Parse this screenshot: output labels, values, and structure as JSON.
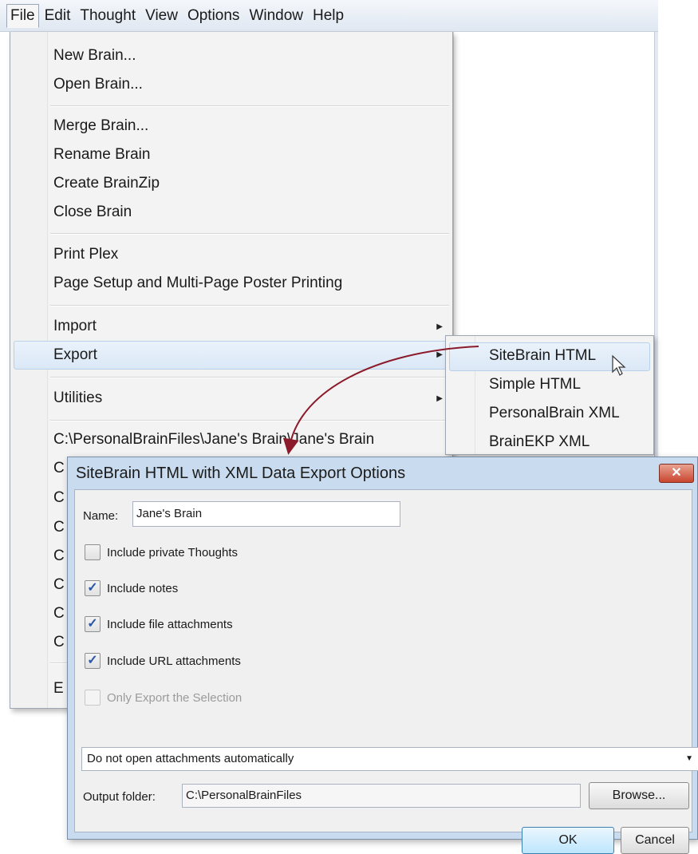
{
  "menubar": {
    "items": [
      "File",
      "Edit",
      "Thought",
      "View",
      "Options",
      "Window",
      "Help"
    ]
  },
  "file_menu": {
    "new_brain": "New Brain...",
    "open_brain": "Open Brain...",
    "merge_brain": "Merge Brain...",
    "rename_brain": "Rename Brain",
    "create_brainzip": "Create BrainZip",
    "close_brain": "Close Brain",
    "print_plex": "Print Plex",
    "page_setup": "Page Setup and Multi-Page Poster Printing",
    "import": "Import",
    "export": "Export",
    "utilities": "Utilities",
    "recent_1": "C:\\PersonalBrainFiles\\Jane's Brain\\Jane's Brain",
    "recent_prefix": "C",
    "exit_prefix": "E"
  },
  "export_submenu": {
    "items": [
      "SiteBrain HTML",
      "Simple HTML",
      "PersonalBrain XML",
      "BrainEKP XML"
    ]
  },
  "dialog": {
    "title": "SiteBrain HTML with XML Data Export Options",
    "close_glyph": "✕",
    "name_label": "Name:",
    "name_value": "Jane's Brain",
    "options": [
      {
        "label": "Include private Thoughts",
        "checked": false,
        "enabled": true
      },
      {
        "label": "Include notes",
        "checked": true,
        "enabled": true
      },
      {
        "label": "Include file attachments",
        "checked": true,
        "enabled": true
      },
      {
        "label": "Include URL attachments",
        "checked": true,
        "enabled": true
      },
      {
        "label": "Only Export the Selection",
        "checked": false,
        "enabled": false
      }
    ],
    "check_glyph": "✓",
    "attachments_select_value": "Do not open attachments automatically",
    "output_folder_label": "Output folder:",
    "output_folder_value": "C:\\PersonalBrainFiles",
    "browse_label": "Browse...",
    "ok_label": "OK",
    "cancel_label": "Cancel"
  },
  "colors": {
    "annotation_arrow": "#8b1a2b",
    "dialog_frame": "#c9dbee",
    "close_button": "#c9452f"
  }
}
